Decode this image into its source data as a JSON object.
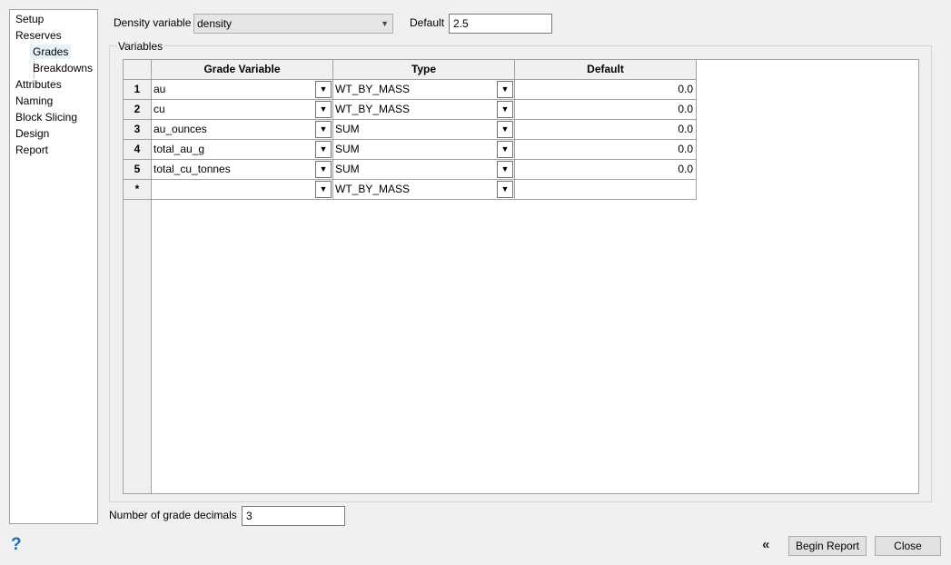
{
  "sidebar": {
    "items": [
      {
        "label": "Setup"
      },
      {
        "label": "Reserves"
      },
      {
        "label": "Grades"
      },
      {
        "label": "Breakdowns"
      },
      {
        "label": "Attributes"
      },
      {
        "label": "Naming"
      },
      {
        "label": "Block Slicing"
      },
      {
        "label": "Design"
      },
      {
        "label": "Report"
      }
    ],
    "selected": "Grades"
  },
  "density": {
    "label": "Density variable",
    "value": "density",
    "default_label": "Default",
    "default_value": "2.5"
  },
  "variables": {
    "group_title": "Variables",
    "columns": [
      "Grade Variable",
      "Type",
      "Default"
    ],
    "rows": [
      {
        "num": "1",
        "grade": "au",
        "type": "WT_BY_MASS",
        "default": "0.0"
      },
      {
        "num": "2",
        "grade": "cu",
        "type": "WT_BY_MASS",
        "default": "0.0"
      },
      {
        "num": "3",
        "grade": "au_ounces",
        "type": "SUM",
        "default": "0.0"
      },
      {
        "num": "4",
        "grade": "total_au_g",
        "type": "SUM",
        "default": "0.0"
      },
      {
        "num": "5",
        "grade": "total_cu_tonnes",
        "type": "SUM",
        "default": "0.0"
      },
      {
        "num": "*",
        "grade": "",
        "type": "WT_BY_MASS",
        "default": ""
      }
    ]
  },
  "decimals": {
    "label": "Number of grade decimals",
    "value": "3"
  },
  "footer": {
    "help_glyph": "?",
    "back_glyph": "«",
    "begin_report_label": "Begin Report",
    "close_label": "Close"
  },
  "icons": {
    "dropdown": "chevron-down-icon",
    "help": "help-icon",
    "back": "double-chevron-left-icon"
  },
  "colors": {
    "help_icon": "#1e6fb8",
    "background": "#f0f0f0"
  }
}
